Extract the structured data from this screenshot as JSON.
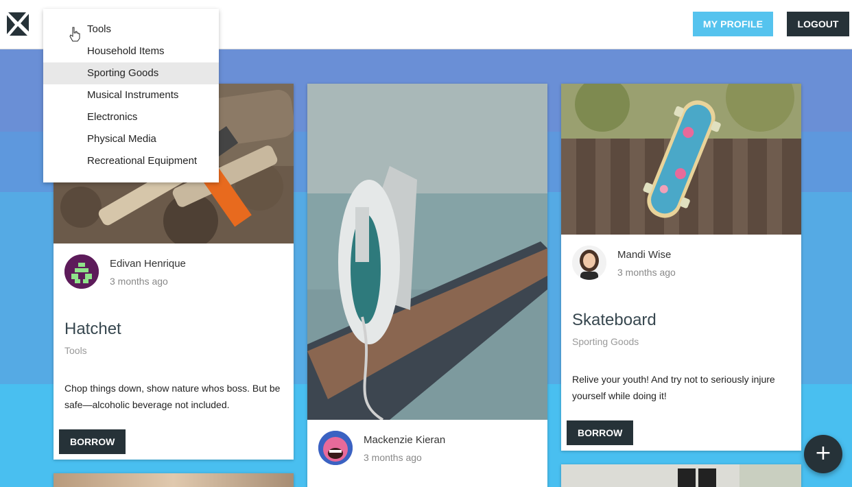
{
  "header": {
    "logo": "x-logo-icon",
    "my_profile_label": "MY PROFILE",
    "logout_label": "LOGOUT"
  },
  "category_menu": {
    "items": [
      "Tools",
      "Household Items",
      "Sporting Goods",
      "Musical Instruments",
      "Electronics",
      "Physical Media",
      "Recreational Equipment"
    ],
    "highlighted": "Sporting Goods"
  },
  "cards": [
    {
      "owner": "Edivan Henrique",
      "time": "3 months ago",
      "title": "Hatchet",
      "category": "Tools",
      "description": "Chop things down, show nature whos boss. But be safe—alcoholic beverage not included.",
      "button": "BORROW"
    },
    {
      "owner": "Mackenzie Kieran",
      "time": "3 months ago"
    },
    {
      "owner": "Mandi Wise",
      "time": "3 months ago",
      "title": "Skateboard",
      "category": "Sporting Goods",
      "description": "Relive your youth! And try not to seriously injure yourself while doing it!",
      "button": "BORROW"
    }
  ],
  "fab": {
    "icon": "plus-icon",
    "label": "+"
  },
  "colors": {
    "accent": "#55c3ee",
    "dark": "#263238",
    "background_top": "#6a8fd6",
    "background_bottom": "#49bff0"
  }
}
